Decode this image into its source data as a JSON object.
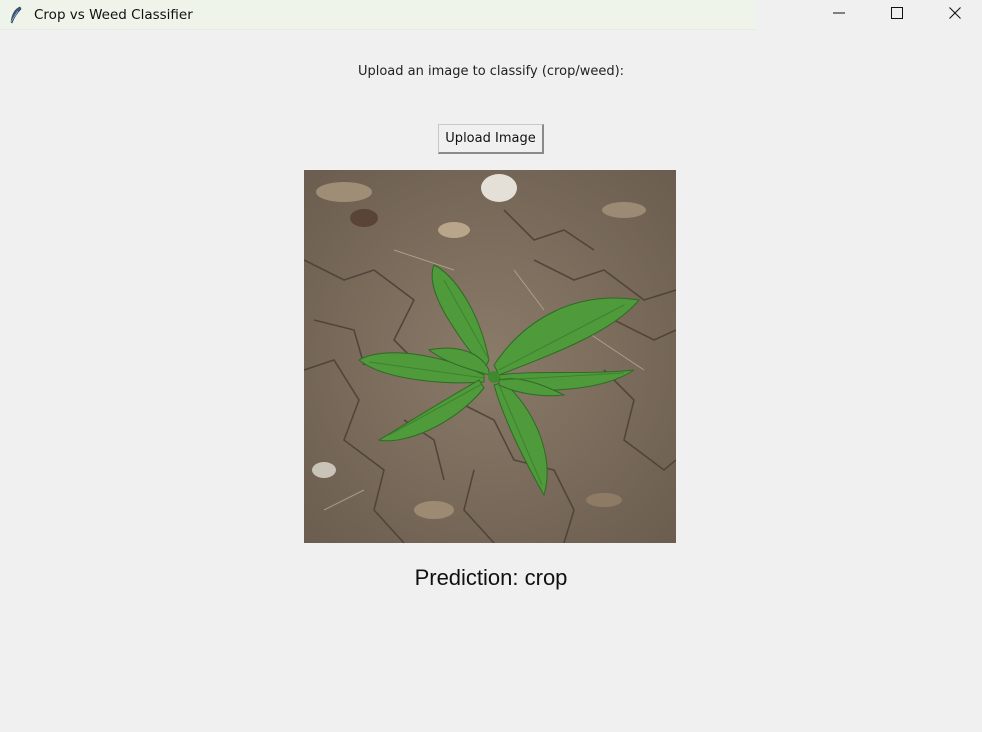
{
  "window": {
    "title": "Crop vs Weed Classifier",
    "app_icon": "feather-icon",
    "controls": [
      "minimize-icon",
      "maximize-icon",
      "close-icon"
    ]
  },
  "main": {
    "instruction": "Upload an image to classify (crop/weed):",
    "upload_button_label": "Upload Image",
    "prediction_text": "Prediction: crop"
  },
  "colors": {
    "background": "#f0f0f0",
    "titlebar_tint": "#eef4ea",
    "soil": "#7d6f60",
    "leaf": "#4f9a3a"
  }
}
